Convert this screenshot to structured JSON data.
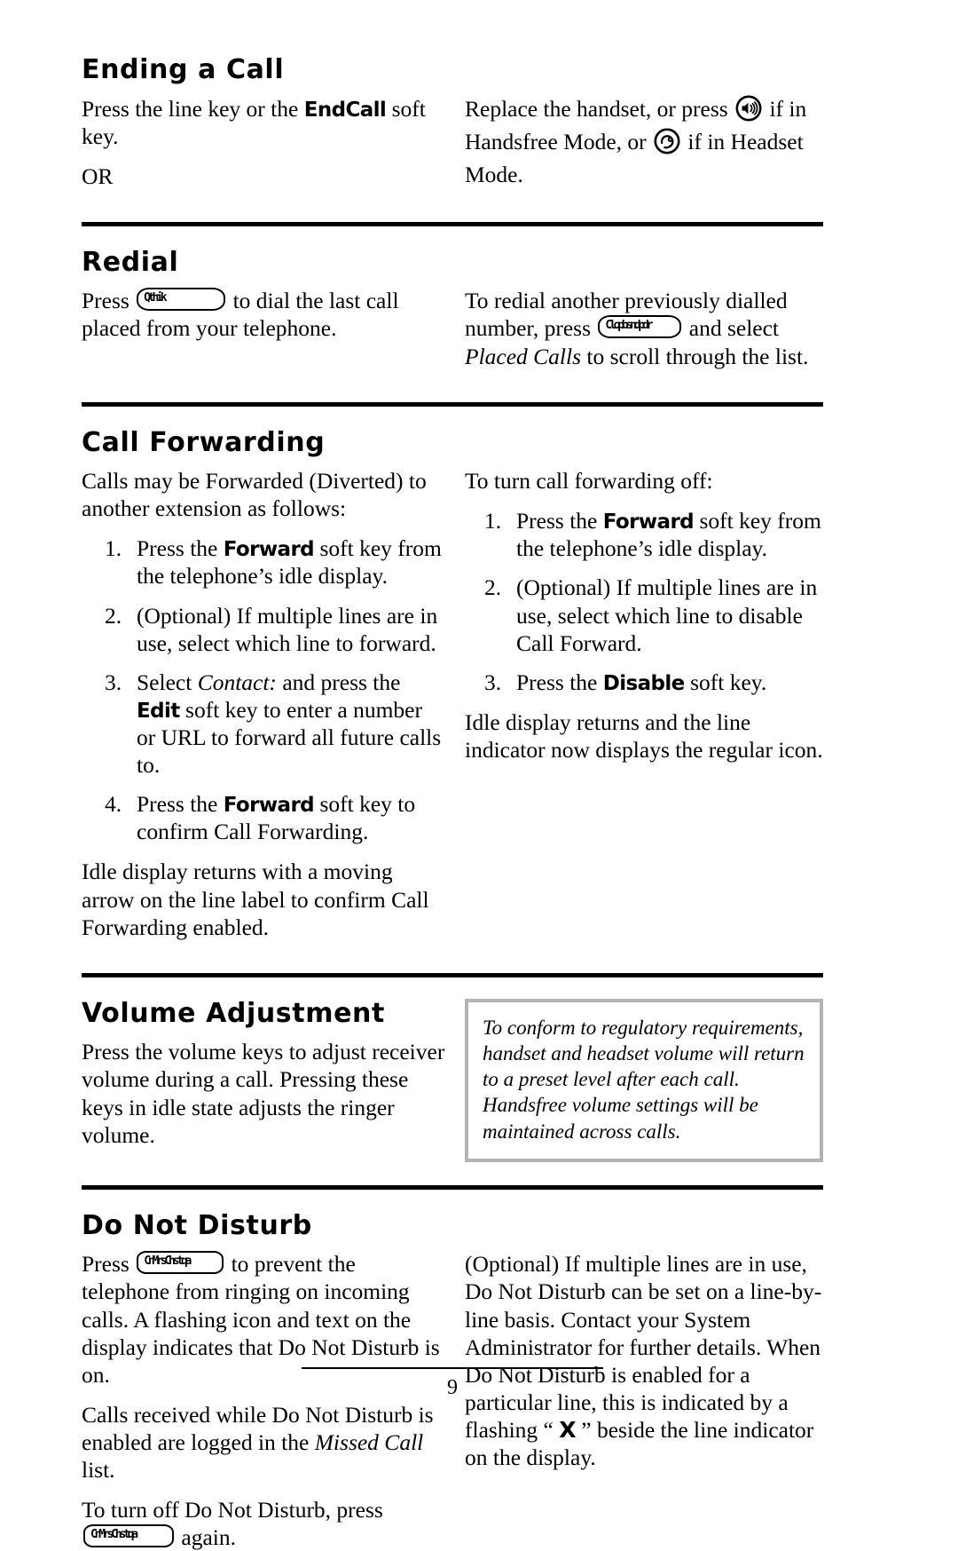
{
  "page": {
    "number": "9"
  },
  "sections": {
    "ending_call": {
      "heading": "Ending a Call",
      "left": {
        "line1_a": "Press the line key or the ",
        "line1_key": "EndCall",
        "line1_b": " soft key.",
        "or": "OR"
      },
      "right": {
        "a": "Replace the handset, or press ",
        "b": " if in Handsfree Mode, or ",
        "c": " if in Headset Mode.",
        "speaker_icon": "speaker-icon",
        "headset_icon": "headset-icon"
      }
    },
    "redial": {
      "heading": "Redial",
      "left": {
        "a": "Press ",
        "key": "Qthik",
        "b": " to dial the last call placed from your telephone."
      },
      "right": {
        "a": "To redial another previously dialled number, press ",
        "key": "Clopbsndpdr",
        "b": " and select ",
        "italic": "Placed Calls",
        "c": " to scroll through the list."
      }
    },
    "call_forwarding": {
      "heading": "Call Forwarding",
      "left": {
        "intro": "Calls may be Forwarded (Diverted) to another extension as follows:",
        "steps": [
          {
            "a": "Press the ",
            "key": "Forward",
            "b": " soft key from the telephone’s idle display."
          },
          {
            "a": "(Optional) If multiple lines are in use, select which line to forward.",
            "key": "",
            "b": ""
          },
          {
            "a": "Select ",
            "italic": "Contact:",
            "mid": " and press the ",
            "key": "Edit",
            "b": " soft key to enter a number or URL to forward all future calls to."
          },
          {
            "a": "Press the ",
            "key": "Forward",
            "b": " soft key to confirm Call Forwarding."
          }
        ],
        "outro": "Idle display returns with a moving arrow on the line label to confirm Call Forwarding enabled."
      },
      "right": {
        "intro": "To turn call forwarding off:",
        "steps": [
          {
            "a": "Press the ",
            "key": "Forward",
            "b": " soft key from the telephone’s idle display."
          },
          {
            "a": "(Optional) If multiple lines are in use, select which line to disable Call Forward.",
            "key": "",
            "b": ""
          },
          {
            "a": "Press the ",
            "key": "Disable",
            "b": " soft key."
          }
        ],
        "outro": "Idle display returns and the line indicator now displays the regular icon."
      }
    },
    "volume": {
      "heading": "Volume Adjustment",
      "left": {
        "text": "Press the volume keys to adjust receiver volume during a call.  Pressing these keys in idle state adjusts the ringer volume."
      },
      "note": {
        "text": "To conform to regulatory requirements, handset and headset volume will return to a preset level after each call.  Handsfree volume settings will be maintained across calls."
      }
    },
    "dnd": {
      "heading": "Do Not Disturb",
      "left": {
        "p1_a": "Press ",
        "p1_key": "CnMrsChstqa",
        "p1_b": " to prevent the telephone from ringing on incoming calls.  A flashing icon and text on the display indicates that Do Not Disturb is on.",
        "p2_a": "Calls received while Do Not Disturb is enabled are logged in the ",
        "p2_italic": "Missed Call",
        "p2_b": " list.",
        "p3_a": "To turn off Do Not Disturb, press ",
        "p3_key": "CnMrsChstqa",
        "p3_b": " again."
      },
      "right": {
        "a": "(Optional) If multiple lines are in use, Do Not Disturb can be set on a line-by-line basis.  Contact your System Administrator for further details.  When Do Not Disturb is enabled for a particular line, this is indicated by a flashing “ ",
        "symbol": "X",
        "b": " ” beside the line indicator on the display."
      }
    }
  },
  "colors": {
    "text": "#000000",
    "background": "#ffffff",
    "note_border": "#b3b3b3",
    "rule": "#000000"
  }
}
